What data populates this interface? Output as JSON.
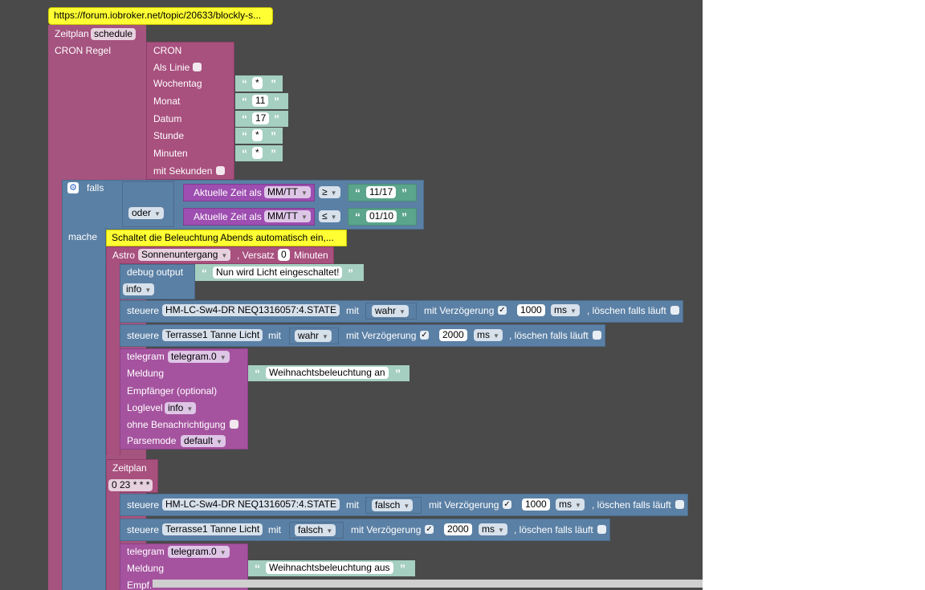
{
  "workspace": {
    "url_comment": "https://forum.iobroker.net/topic/20633/blockly-s...",
    "schedule_block": {
      "label": "Zeitplan",
      "mode": "schedule",
      "cron_label": "CRON Regel"
    },
    "cron_block": {
      "title": "CRON",
      "as_line_label": "Als Linie",
      "weekday_label": "Wochentag",
      "weekday_value": "*",
      "month_label": "Monat",
      "month_value": "11",
      "date_label": "Datum",
      "date_value": "17",
      "hour_label": "Stunde",
      "hour_value": "*",
      "minutes_label": "Minuten",
      "minutes_value": "*",
      "seconds_label": "mit Sekunden"
    },
    "if_block": {
      "label": "falls",
      "or_label": "oder",
      "do_label": "mache",
      "cond1": {
        "time_label": "Aktuelle Zeit als",
        "format": "MM/TT",
        "operator": "≥",
        "value": "11/17"
      },
      "cond2": {
        "time_label": "Aktuelle Zeit als",
        "format": "MM/TT",
        "operator": "≤",
        "value": "01/10"
      }
    },
    "do_comment": "Schaltet die Beleuchtung Abends automatisch ein,...",
    "astro_block": {
      "label": "Astro",
      "event": "Sonnenuntergang",
      "offset_label": ", Versatz",
      "offset_value": "0",
      "unit": "Minuten"
    },
    "debug_block": {
      "label": "debug output",
      "text": "Nun wird Licht eingeschaltet!",
      "level": "info"
    },
    "control1": {
      "label": "steuere",
      "device": "HM-LC-Sw4-DR NEQ1316057:4.STATE",
      "with": "mit",
      "value": "wahr",
      "delay_label": "mit Verzögerung",
      "check": "✓",
      "delay": "1000",
      "unit": "ms",
      "clear_label": ", löschen falls läuft"
    },
    "control2": {
      "label": "steuere",
      "device": "Terrasse1 Tanne Licht",
      "with": "mit",
      "value": "wahr",
      "delay_label": "mit Verzögerung",
      "check": "✓",
      "delay": "2000",
      "unit": "ms",
      "clear_label": ", löschen falls läuft"
    },
    "telegram1": {
      "label": "telegram",
      "instance": "telegram.0",
      "message_label": "Meldung",
      "message": "Weihnachtsbeleuchtung an",
      "recipient_label": "Empfänger (optional)",
      "loglevel_label": "Loglevel",
      "loglevel": "info",
      "silent_label": "ohne Benachrichtigung",
      "parsemode_label": "Parsemode",
      "parsemode": "default"
    },
    "schedule2": {
      "label": "Zeitplan",
      "cron": "0 23 * * *"
    },
    "control3": {
      "label": "steuere",
      "device": "HM-LC-Sw4-DR NEQ1316057:4.STATE",
      "with": "mit",
      "value": "falsch",
      "delay_label": "mit Verzögerung",
      "check": "✓",
      "delay": "1000",
      "unit": "ms",
      "clear_label": ", löschen falls läuft"
    },
    "control4": {
      "label": "steuere",
      "device": "Terrasse1 Tanne Licht",
      "with": "mit",
      "value": "falsch",
      "delay_label": "mit Verzögerung",
      "check": "✓",
      "delay": "2000",
      "unit": "ms",
      "clear_label": ", löschen falls läuft"
    },
    "telegram2": {
      "label": "telegram",
      "instance": "telegram.0",
      "message_label": "Meldung",
      "message": "Weihnachtsbeleuchtung aus",
      "recipient_label": "Empf..."
    }
  },
  "colors": {
    "workspace": "#4a4a4a",
    "schedule": "#a5537f",
    "logic": "#5b80a5",
    "time": "#9d4eb0",
    "text": "#a5cfc0",
    "comment": "#ffff33"
  }
}
